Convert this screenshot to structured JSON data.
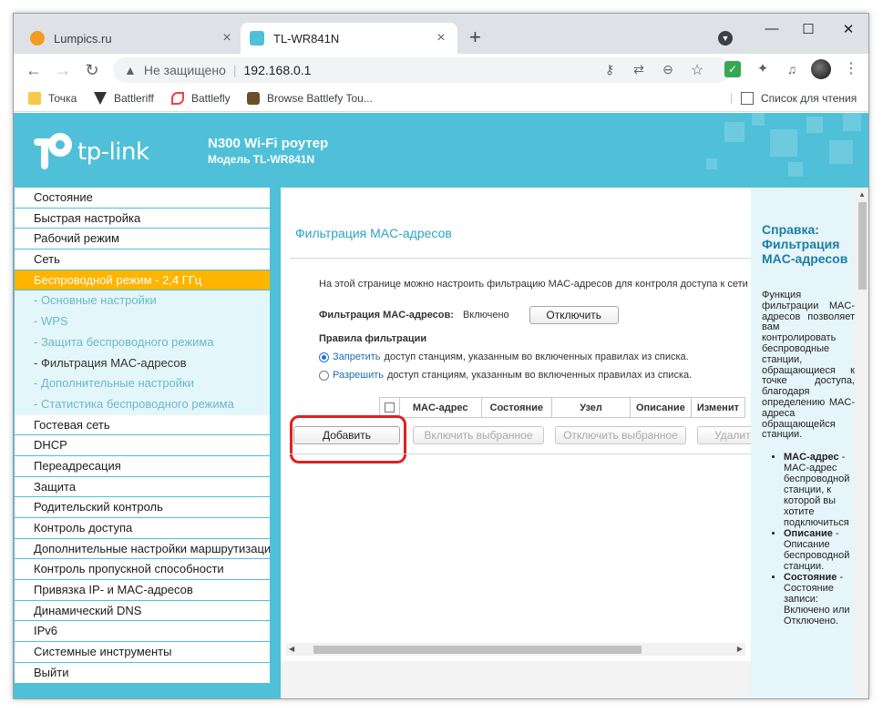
{
  "tabs": [
    {
      "title": "Lumpics.ru",
      "close": "×"
    },
    {
      "title": "TL-WR841N",
      "close": "×"
    }
  ],
  "newtab": "+",
  "window_controls": {
    "minimize": "—",
    "maximize": "☐",
    "close": "✕"
  },
  "toolbar": {
    "back": "←",
    "forward": "→",
    "reload": "↻",
    "security_text": "Не защищено",
    "url": "192.168.0.1"
  },
  "bookmarks": [
    {
      "label": "Точка"
    },
    {
      "label": "Battleriff"
    },
    {
      "label": "Battlefly"
    },
    {
      "label": "Browse Battlefy Tou..."
    }
  ],
  "reading_list": "Список для чтения",
  "router": {
    "brand": "tp-link",
    "model_title": "N300 Wi-Fi роутер",
    "model_sub": "Модель TL-WR841N"
  },
  "sidebar": {
    "items": [
      {
        "label": "Состояние",
        "type": "top"
      },
      {
        "label": "Быстрая настройка",
        "type": "top"
      },
      {
        "label": "Рабочий режим",
        "type": "top"
      },
      {
        "label": "Сеть",
        "type": "top"
      },
      {
        "label": "Беспроводной режим - 2,4 ГГц",
        "type": "active"
      },
      {
        "label": "- Основные настройки",
        "type": "sub"
      },
      {
        "label": "- WPS",
        "type": "sub"
      },
      {
        "label": "- Защита беспроводного режима",
        "type": "sub"
      },
      {
        "label": "- Фильтрация MAC-адресов",
        "type": "sub-current"
      },
      {
        "label": "- Дополнительные настройки",
        "type": "sub"
      },
      {
        "label": "- Статистика беспроводного режима",
        "type": "sub"
      },
      {
        "label": "Гостевая сеть",
        "type": "top"
      },
      {
        "label": "DHCP",
        "type": "top"
      },
      {
        "label": "Переадресация",
        "type": "top"
      },
      {
        "label": "Защита",
        "type": "top"
      },
      {
        "label": "Родительский контроль",
        "type": "top"
      },
      {
        "label": "Контроль доступа",
        "type": "top"
      },
      {
        "label": "Дополнительные настройки маршрутизации",
        "type": "top"
      },
      {
        "label": "Контроль пропускной способности",
        "type": "top"
      },
      {
        "label": "Привязка IP- и MAC-адресов",
        "type": "top"
      },
      {
        "label": "Динамический DNS",
        "type": "top"
      },
      {
        "label": "IPv6",
        "type": "top"
      },
      {
        "label": "Системные инструменты",
        "type": "top"
      },
      {
        "label": "Выйти",
        "type": "top"
      }
    ]
  },
  "content": {
    "title": "Фильтрация MAC-адресов",
    "description": "На этой странице можно настроить фильтрацию MAC-адресов для контроля доступа к сети г",
    "filter_label": "Фильтрация MAC-адресов:",
    "filter_state": "Включено",
    "toggle_button": "Отключить",
    "rules_label": "Правила фильтрации",
    "deny_keyword": "Запретить",
    "deny_text": "доступ станциям, указанным во включенных правилах из списка.",
    "allow_keyword": "Разрешить",
    "allow_text": "доступ станциям, указанным во включенных правилах из списка.",
    "table_headers": [
      "MAC-адрес",
      "Состояние",
      "Узел",
      "Описание",
      "Изменит"
    ],
    "buttons": {
      "add": "Добавить",
      "enable_selected": "Включить выбранное",
      "disable_selected": "Отключить выбранное",
      "delete": "Удалит"
    }
  },
  "help": {
    "title": "Справка: Фильтрация MAC-адресов",
    "text": "Функция фильтрации MAC-адресов позволяет вам контролировать беспроводные станции, обращающиеся к точке доступа, благодаря определению MAC-адреса обращающейся станции.",
    "items": [
      {
        "term": "MAC-адрес",
        "text": "- MAC-адрес беспроводной станции, к которой вы хотите подключиться"
      },
      {
        "term": "Описание",
        "text": "- Описание беспроводной станции."
      },
      {
        "term": "Состояние",
        "text": "- Состояние записи: Включено или Отключено."
      }
    ]
  }
}
